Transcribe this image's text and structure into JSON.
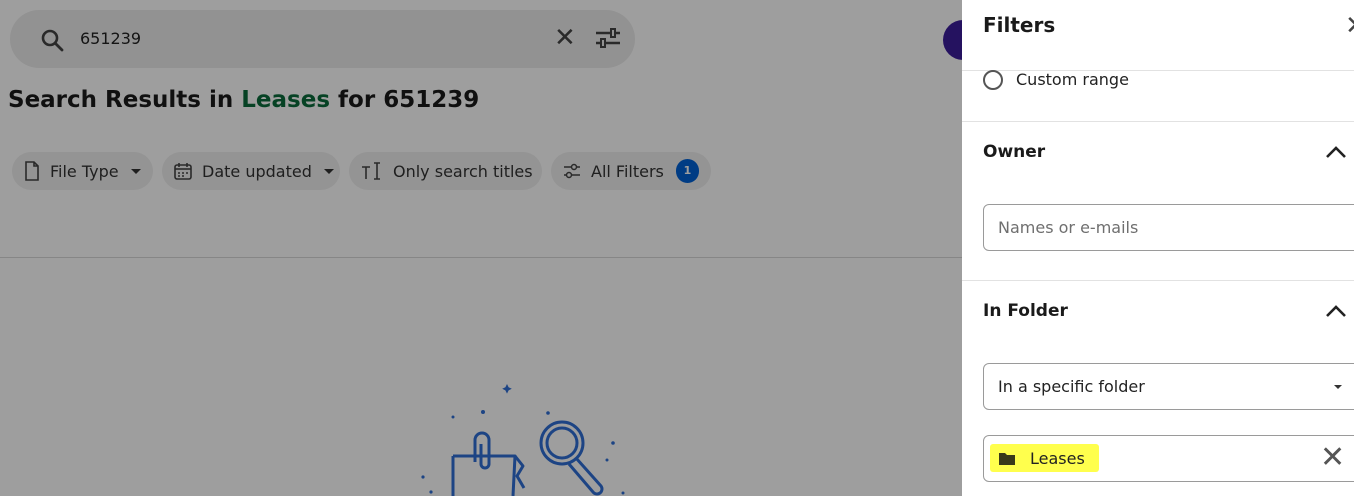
{
  "search": {
    "query": "651239"
  },
  "results_title": {
    "prefix": "Search Results in ",
    "folder": "Leases",
    "middle": " for ",
    "query": "651239"
  },
  "filter_chips": [
    {
      "label": "File Type",
      "icon": "file-icon"
    },
    {
      "label": "Date updated",
      "icon": "calendar-icon"
    },
    {
      "label": "Only search titles",
      "icon": "text-cursor-icon"
    },
    {
      "label": "All Filters",
      "icon": "sliders-icon",
      "badge": "1"
    }
  ],
  "panel": {
    "title": "Filters",
    "date_option": "Custom range",
    "owner": {
      "title": "Owner",
      "placeholder": "Names or e-mails"
    },
    "in_folder": {
      "title": "In Folder",
      "select_value": "In a specific folder",
      "selected_folder": "Leases"
    }
  },
  "colors": {
    "accent_blue": "#0061d5",
    "highlight": "#ffff4d",
    "avatar": "#3d1d9b",
    "overlay": "rgba(0,0,0,0.38)"
  }
}
